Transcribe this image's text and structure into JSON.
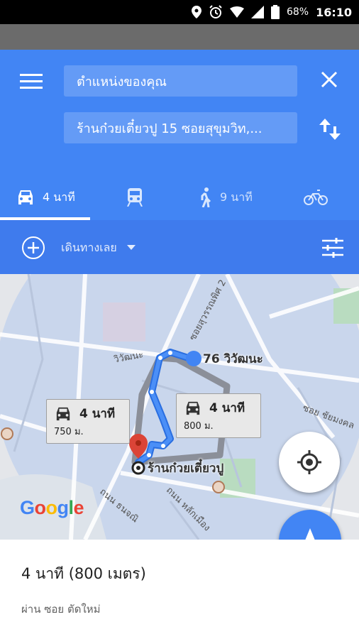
{
  "status_bar": {
    "battery": "68%",
    "time": "16:10",
    "icons": [
      "location-icon",
      "alarm-icon",
      "wifi-icon",
      "signal-icon",
      "battery-icon"
    ]
  },
  "header": {
    "from_field": "ตำแหน่งของคุณ",
    "to_field": "ร้านก๋วยเตี๋ยวปู 15 ซอยสุขุมวิท,...",
    "modes": [
      {
        "icon": "car-icon",
        "label": "4 นาที",
        "selected": true
      },
      {
        "icon": "train-icon",
        "label": ""
      },
      {
        "icon": "walk-icon",
        "label": "9 นาที"
      },
      {
        "icon": "bike-icon",
        "label": ""
      }
    ]
  },
  "departure_bar": {
    "label": "เดินทางเลย"
  },
  "map": {
    "origin_label": "76 วิวัฒนะ",
    "destination_label": "ร้านก๋วยเตี๋ยวปู",
    "roads": [
      "วิวัฒนะ",
      "ซอยสุวรรณพิศ 2",
      "ถนน หลักเมือง",
      "ถนน ธนจณิ",
      "ซอย ชัยมงคล"
    ],
    "route_main": {
      "time": "4 นาที",
      "distance": "800 ม."
    },
    "route_alt": {
      "time": "4 นาที",
      "distance": "750 ม."
    },
    "logo": [
      "G",
      "o",
      "o",
      "g",
      "l",
      "e"
    ],
    "logo_colors": [
      "#4285f4",
      "#ea4335",
      "#fbbc05",
      "#4285f4",
      "#34a853",
      "#ea4335"
    ]
  },
  "summary": {
    "duration": "4 นาที (800 เมตร)",
    "via": "ผ่าน ซอย ตัดใหม่"
  },
  "colors": {
    "brand_blue": "#4285f4",
    "depbar_blue": "#3f7bed",
    "route_blue": "#4285f4"
  }
}
